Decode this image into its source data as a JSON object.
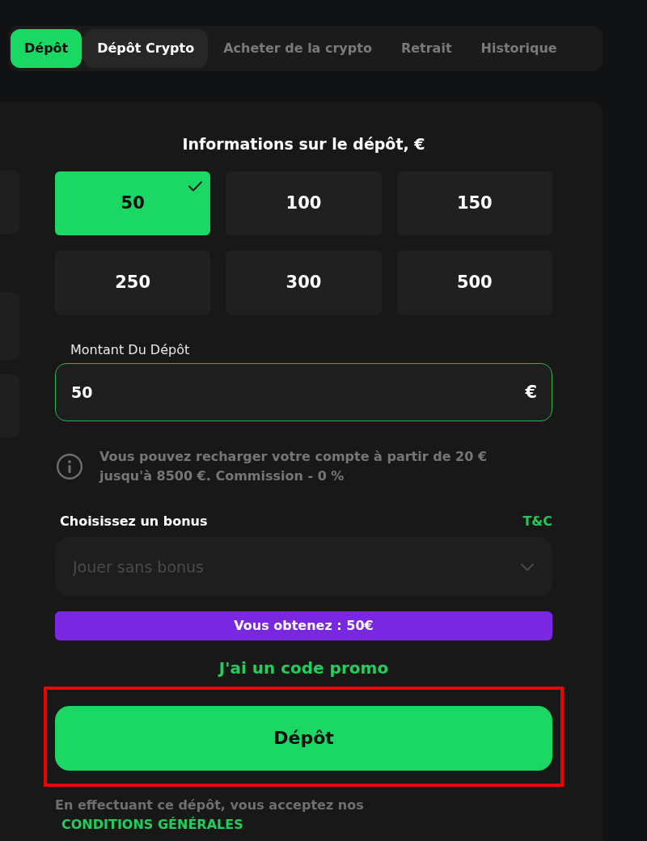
{
  "tabs": [
    {
      "label": "Dépôt",
      "selected": true,
      "hovered": false
    },
    {
      "label": "Dépôt Crypto",
      "selected": false,
      "hovered": true
    },
    {
      "label": "Acheter de la crypto",
      "selected": false,
      "hovered": false
    },
    {
      "label": "Retrait",
      "selected": false,
      "hovered": false
    },
    {
      "label": "Historique",
      "selected": false,
      "hovered": false
    }
  ],
  "deposit_form": {
    "title": "Informations sur le dépôt, €",
    "amounts": [
      {
        "label": "50",
        "selected": true
      },
      {
        "label": "100",
        "selected": false
      },
      {
        "label": "150",
        "selected": false
      },
      {
        "label": "250",
        "selected": false
      },
      {
        "label": "300",
        "selected": false
      },
      {
        "label": "500",
        "selected": false
      }
    ],
    "amount_field": {
      "label": "Montant Du Dépôt",
      "value": "50",
      "currency": "€",
      "focused": true
    },
    "info": "Vous pouvez recharger votre compte à partir de 20 € jusqu'à 8500 €. Commission - 0 %",
    "bonus": {
      "label": "Choisissez un bonus",
      "terms_link": "T&C",
      "select": {
        "placeholder": "Jouer sans bonus"
      }
    },
    "total_banner": "Vous obtenez : 50€",
    "promo_link": "J'ai un code promo",
    "submit_button": {
      "label": "Dépôt",
      "highlighted": true
    },
    "footer": {
      "text": "En effectuant ce dépôt, vous acceptez nos",
      "link": "CONDITIONS GÉNÉRALES"
    }
  }
}
